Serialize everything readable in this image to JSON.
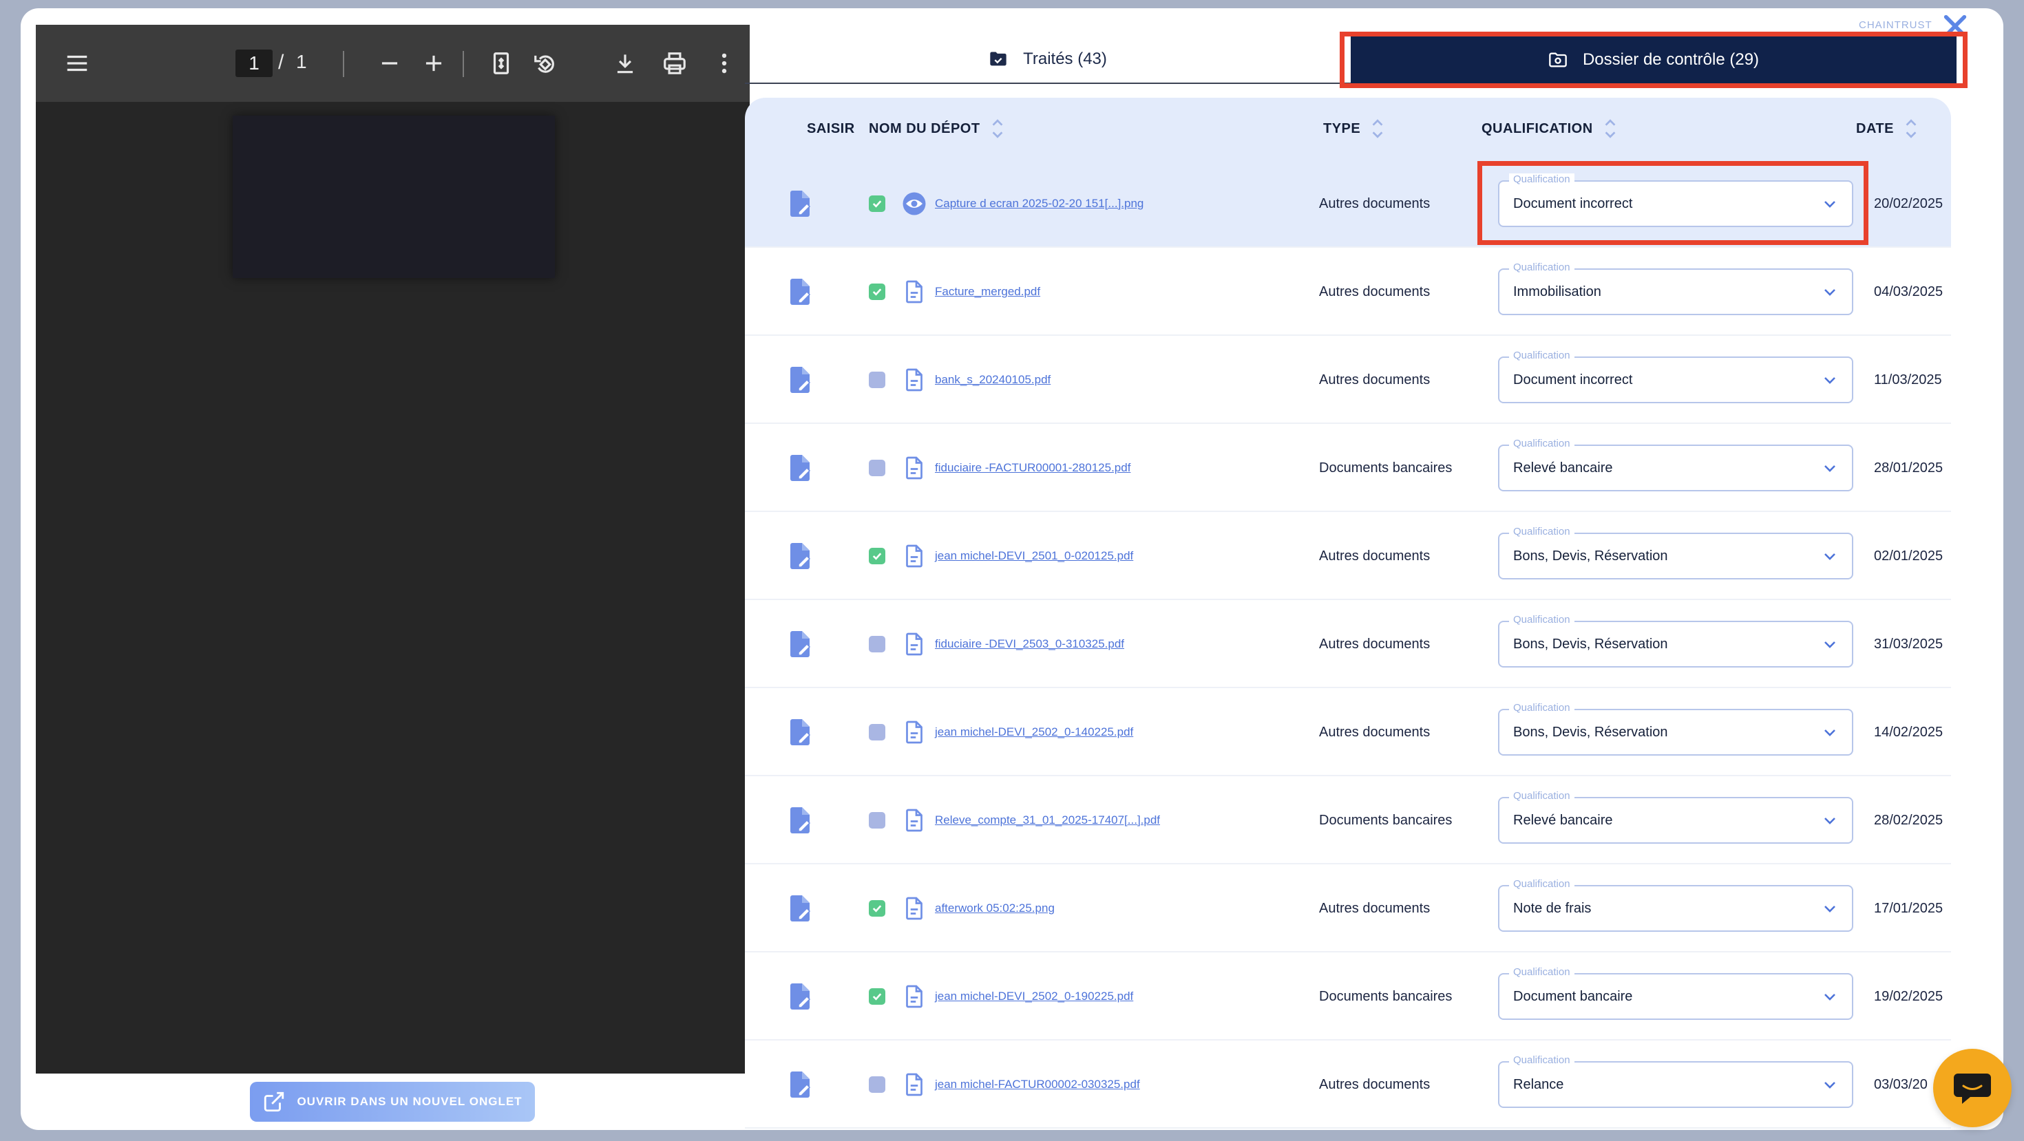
{
  "viewer": {
    "page_current": "1",
    "page_separator": "/",
    "page_total": "1",
    "open_new_tab_label": "OUVRIR DANS UN NOUVEL ONGLET",
    "toolbar_icons": [
      "menu-icon",
      "zoom-out-icon",
      "zoom-in-icon",
      "fit-page-icon",
      "rotate-icon",
      "download-icon",
      "print-icon",
      "more-vert-icon"
    ]
  },
  "brand": "CHAINTRUST",
  "tabs": {
    "traites": "Traités (43)",
    "dossier": "Dossier de contrôle (29)"
  },
  "table": {
    "headers": {
      "saisir": "SAISIR",
      "nom": "NOM DU DÉPOT",
      "type": "TYPE",
      "qualification": "QUALIFICATION",
      "date": "DATE"
    },
    "qualification_label": "Qualification",
    "rows": [
      {
        "name": "Capture d ecran 2025-02-20 151[...].png",
        "type": "Autres documents",
        "qualification": "Document incorrect",
        "date": "20/02/2025",
        "checked": true,
        "file_icon": "eye-icon",
        "selected": true
      },
      {
        "name": "Facture_merged.pdf",
        "type": "Autres documents",
        "qualification": "Immobilisation",
        "date": "04/03/2025",
        "checked": true,
        "file_icon": "file-icon"
      },
      {
        "name": "bank_s_20240105.pdf",
        "type": "Autres documents",
        "qualification": "Document incorrect",
        "date": "11/03/2025",
        "checked": false,
        "file_icon": "file-icon"
      },
      {
        "name": "fiduciaire -FACTUR00001-280125.pdf",
        "type": "Documents bancaires",
        "qualification": "Relevé bancaire",
        "date": "28/01/2025",
        "checked": false,
        "file_icon": "file-icon"
      },
      {
        "name": "jean michel-DEVI_2501_0-020125.pdf",
        "type": "Autres documents",
        "qualification": "Bons, Devis, Réservation",
        "date": "02/01/2025",
        "checked": true,
        "file_icon": "file-icon"
      },
      {
        "name": "fiduciaire -DEVI_2503_0-310325.pdf",
        "type": "Autres documents",
        "qualification": "Bons, Devis, Réservation",
        "date": "31/03/2025",
        "checked": false,
        "file_icon": "file-icon"
      },
      {
        "name": "jean michel-DEVI_2502_0-140225.pdf",
        "type": "Autres documents",
        "qualification": "Bons, Devis, Réservation",
        "date": "14/02/2025",
        "checked": false,
        "file_icon": "file-icon"
      },
      {
        "name": "Releve_compte_31_01_2025-17407[...].pdf",
        "type": "Documents bancaires",
        "qualification": "Relevé bancaire",
        "date": "28/02/2025",
        "checked": false,
        "file_icon": "file-icon"
      },
      {
        "name": "afterwork 05:02:25.png",
        "type": "Autres documents",
        "qualification": "Note de frais",
        "date": "17/01/2025",
        "checked": true,
        "file_icon": "file-icon"
      },
      {
        "name": "jean michel-DEVI_2502_0-190225.pdf",
        "type": "Documents bancaires",
        "qualification": "Document bancaire",
        "date": "19/02/2025",
        "checked": true,
        "file_icon": "file-icon"
      },
      {
        "name": "jean michel-FACTUR00002-030325.pdf",
        "type": "Autres documents",
        "qualification": "Relance",
        "date": "03/03/20",
        "checked": false,
        "file_icon": "file-icon"
      }
    ]
  },
  "colors": {
    "accent": "#4d73d9",
    "highlight": "#e8412c",
    "active_tab": "#10224a",
    "checked": "#58c98a",
    "chat": "#f4a81d"
  }
}
